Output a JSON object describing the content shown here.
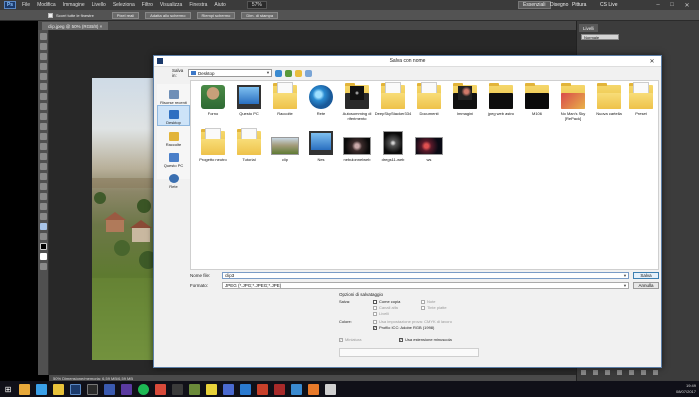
{
  "photoshop": {
    "logo": "Ps",
    "menus": [
      "File",
      "Modifica",
      "Immagine",
      "Livello",
      "Seleziona",
      "Filtro",
      "Visualizza",
      "Finestra",
      "Aiuto"
    ],
    "zoom": "57%",
    "workspaces": [
      "Essenziali",
      "Disegno",
      "Pittura"
    ],
    "active_workspace": "Essenziali",
    "cs_live": "CS Live",
    "options_bar": {
      "checkbox_label": "Scorri tutte le finestre",
      "buttons": [
        "Pixel reali",
        "Adatta allo schermo",
        "Riempi schermo",
        "Dim. di stampa"
      ]
    },
    "document_tab": "clip.jpeg @ 50% (RGB/8) ×",
    "status_bar": "50%      Dimensione/memoria: 6,59 MB/6,59 MB",
    "panels": {
      "tab": "Livelli",
      "blend_mode": "Normale",
      "layer_name": "Sfondo"
    }
  },
  "dialog": {
    "title": "Salva con nome",
    "look_in_label": "Salva in:",
    "look_in_value": "Desktop",
    "places": [
      "Risorse recenti",
      "Desktop",
      "Raccolte",
      "Questo PC",
      "Rete"
    ],
    "selected_place": "Desktop",
    "files": [
      {
        "name": "Forno",
        "kind": "user"
      },
      {
        "name": "Questo PC",
        "kind": "pc"
      },
      {
        "name": "Raccolte",
        "kind": "libraries"
      },
      {
        "name": "Rete",
        "kind": "network"
      },
      {
        "name": "Autosomming di riferimento",
        "kind": "folder-dark"
      },
      {
        "name": "DeepSkyStacker334",
        "kind": "folder-doc"
      },
      {
        "name": "Documenti",
        "kind": "folder-doc"
      },
      {
        "name": "Immagini",
        "kind": "folder-space"
      },
      {
        "name": "jpeg web astro",
        "kind": "folder-black"
      },
      {
        "name": "M106",
        "kind": "folder-black"
      },
      {
        "name": "No Man's Sky [RePack]",
        "kind": "folder-game"
      },
      {
        "name": "Nuova cartella",
        "kind": "folder"
      },
      {
        "name": "Preset",
        "kind": "folder-doc"
      },
      {
        "name": "Progetto neutro",
        "kind": "folder-doc"
      },
      {
        "name": "Tutorial",
        "kind": "folder-doc"
      },
      {
        "name": "clip",
        "kind": "image-landscape"
      },
      {
        "name": "Nes",
        "kind": "pc"
      },
      {
        "name": "nebulonnelweb",
        "kind": "image-space"
      },
      {
        "name": "dregs11-web",
        "kind": "image-space"
      },
      {
        "name": "ws",
        "kind": "image-nebula"
      }
    ],
    "filename_label": "Nome file:",
    "filename_value": "clip3",
    "format_label": "Formato:",
    "format_value": "JPEG (*.JPG;*.JPEG;*.JPE)",
    "save_button": "Salva",
    "cancel_button": "Annulla",
    "options": {
      "header": "Opzioni di salvataggio",
      "save_label": "Salva:",
      "as_copy": "Come copia",
      "annotations": "Note",
      "alpha": "Canali alfa",
      "spot": "Tinte piatte",
      "layers": "Livelli",
      "color_label": "Colore:",
      "use_proof": "Usa impostazione prova:  CMYK di lavoro",
      "icc_profile": "Profilo ICC:  Adobe RGB (1998)",
      "thumbnail": "Miniatura",
      "lower_ext": "Usa estensione minuscola"
    }
  },
  "taskbar": {
    "time": "19:49",
    "date": "08/07/2017"
  },
  "colors": {
    "dialog_border": "#5c7fa8",
    "selection": "#cde3f8",
    "folder": "#eec24a"
  }
}
